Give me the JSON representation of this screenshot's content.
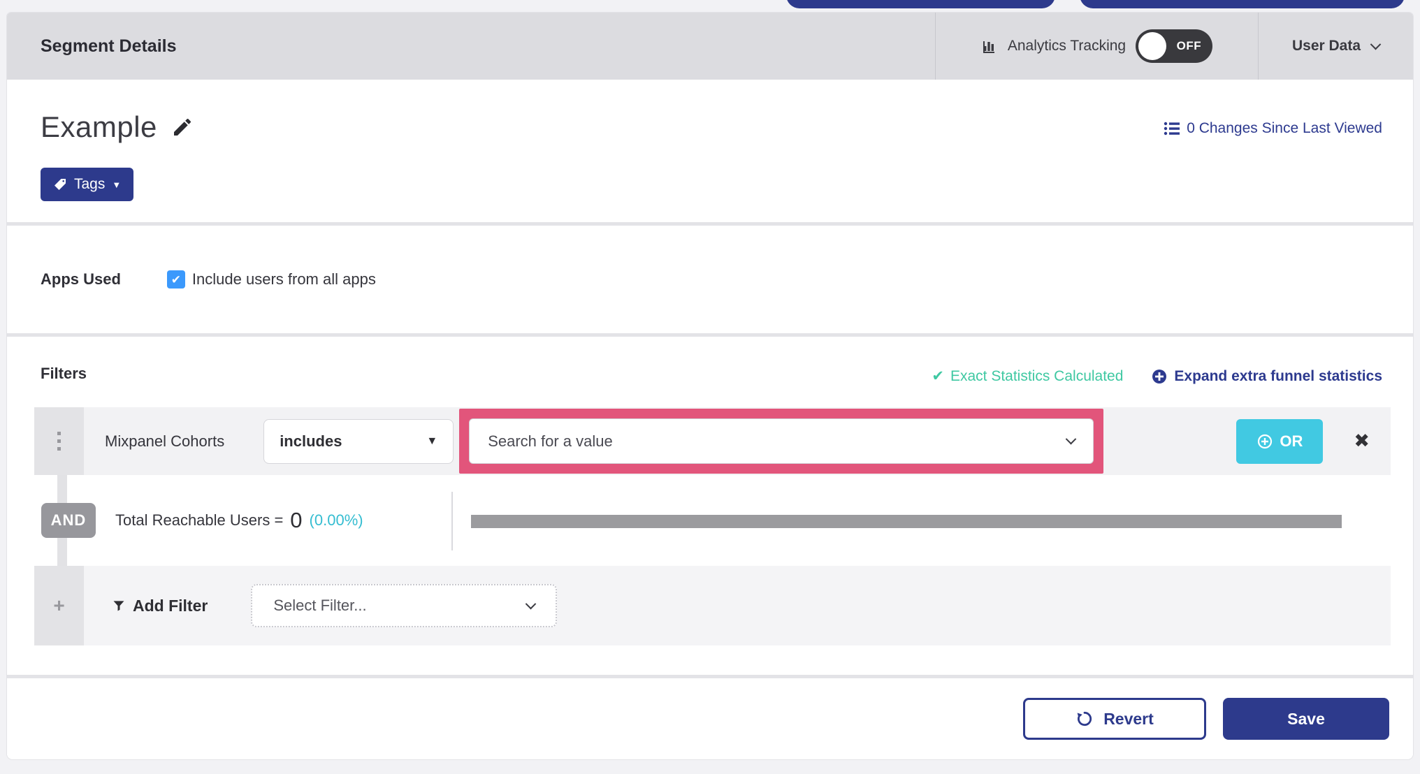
{
  "header": {
    "title": "Segment Details",
    "analytics_label": "Analytics Tracking",
    "toggle_state": "OFF",
    "user_data_label": "User Data"
  },
  "title_section": {
    "segment_name": "Example",
    "changes_link": "0 Changes Since Last Viewed",
    "tags_button_label": "Tags"
  },
  "apps_section": {
    "label": "Apps Used",
    "checkbox_checked": true,
    "checkbox_label": "Include users from all apps"
  },
  "filters": {
    "heading": "Filters",
    "exact_stats_label": "Exact Statistics Calculated",
    "expand_link_label": "Expand extra funnel statistics",
    "filter_row": {
      "field": "Mixpanel Cohorts",
      "operator": "includes",
      "value_placeholder": "Search for a value",
      "or_button_label": "OR"
    },
    "and_badge": "AND",
    "reachable_label": "Total Reachable Users =",
    "reachable_value": "0",
    "reachable_pct": "(0.00%)",
    "add_filter_label": "Add Filter",
    "select_filter_placeholder": "Select Filter..."
  },
  "footer": {
    "revert_label": "Revert",
    "save_label": "Save"
  },
  "icons": {
    "caret_down": "▼",
    "check": "✔",
    "close": "✖",
    "plus": "+"
  },
  "colors": {
    "navy": "#2d3a8c",
    "cyan_or": "#41c9e2",
    "teal_success": "#3fc8a2",
    "cyan_pct": "#35bdd1",
    "checkbox_blue": "#3b99fc",
    "highlight_pink": "#e2557b",
    "header_gray": "#dcdce0",
    "toggle_dark": "#39393d",
    "progress_gray": "#9b9b9e"
  }
}
